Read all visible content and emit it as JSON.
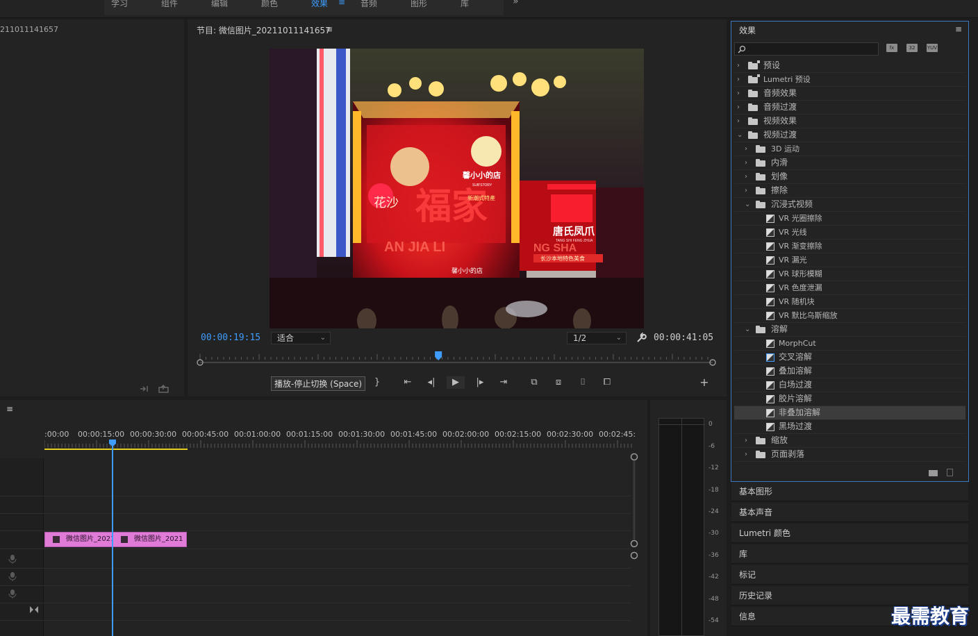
{
  "workspace": {
    "tabs": [
      {
        "label": "学习"
      },
      {
        "label": "组件"
      },
      {
        "label": "编辑"
      },
      {
        "label": "颜色"
      },
      {
        "label": "效果",
        "active": true
      },
      {
        "label": "音频"
      },
      {
        "label": "图形"
      },
      {
        "label": "库"
      }
    ],
    "more": "»",
    "active_menu": "≡"
  },
  "source": {
    "title": "211011141657"
  },
  "program": {
    "title": "节目: 微信图片_20211011141657",
    "menu": "≡",
    "timecode_current": "00:00:19:15",
    "timecode_duration": "00:00:41:05",
    "fit_value": "适合",
    "resolution_value": "1/2",
    "playhead_fraction": 0.465,
    "tooltip": "播放-停止切换 (Space)",
    "scene": {
      "sign_big": "福家",
      "sign_right": "唐氏凤爪",
      "sign_right_sub": "TANG SHI FENG ZHUA",
      "sign_left": "花沙",
      "sign_mid": "馨小小的店",
      "sign_mid_sub": "SUB'STORY",
      "sign_banner": "新潮式特產",
      "sign_bottom": "馨小小的店",
      "sign_red_strip": "长沙本地特色美食",
      "sign_roman": "AN JIA LI",
      "sign_roman2": "NG SHA"
    }
  },
  "timeline": {
    "menu": "≡",
    "ruler": [
      ":00:00",
      "00:00:15:00",
      "00:00:30:00",
      "00:00:45:00",
      "00:01:00:00",
      "00:01:15:00",
      "00:01:30:00",
      "00:01:45:00",
      "00:02:00:00",
      "00:02:15:00",
      "00:02:30:00",
      "00:02:45:"
    ],
    "clips": [
      {
        "label": "微信图片_2021"
      },
      {
        "label": "微信图片_2021"
      }
    ]
  },
  "meter": {
    "db_labels": [
      "0",
      "-6",
      "-12",
      "-18",
      "-24",
      "-30",
      "-36",
      "-42",
      "-48",
      "-54"
    ]
  },
  "effects": {
    "title": "效果",
    "menu": "≡",
    "search_value": "",
    "tools": [
      "fx",
      "32",
      "YUV"
    ],
    "tree": [
      {
        "label": "预设",
        "depth": 0,
        "kind": "preset",
        "open": false
      },
      {
        "label": "Lumetri 预设",
        "depth": 0,
        "kind": "preset",
        "open": false
      },
      {
        "label": "音频效果",
        "depth": 0,
        "kind": "folder",
        "open": false
      },
      {
        "label": "音频过渡",
        "depth": 0,
        "kind": "folder",
        "open": false
      },
      {
        "label": "视频效果",
        "depth": 0,
        "kind": "folder",
        "open": false
      },
      {
        "label": "视频过渡",
        "depth": 0,
        "kind": "folder",
        "open": true
      },
      {
        "label": "3D 运动",
        "depth": 1,
        "kind": "folder",
        "open": false
      },
      {
        "label": "内滑",
        "depth": 1,
        "kind": "folder",
        "open": false
      },
      {
        "label": "划像",
        "depth": 1,
        "kind": "folder",
        "open": false
      },
      {
        "label": "擦除",
        "depth": 1,
        "kind": "folder",
        "open": false
      },
      {
        "label": "沉浸式视频",
        "depth": 1,
        "kind": "folder",
        "open": true
      },
      {
        "label": "VR 光圈擦除",
        "depth": 2,
        "kind": "effect"
      },
      {
        "label": "VR 光线",
        "depth": 2,
        "kind": "effect"
      },
      {
        "label": "VR 渐变擦除",
        "depth": 2,
        "kind": "effect"
      },
      {
        "label": "VR 漏光",
        "depth": 2,
        "kind": "effect"
      },
      {
        "label": "VR 球形模糊",
        "depth": 2,
        "kind": "effect"
      },
      {
        "label": "VR 色度泄漏",
        "depth": 2,
        "kind": "effect"
      },
      {
        "label": "VR 随机块",
        "depth": 2,
        "kind": "effect"
      },
      {
        "label": "VR 默比乌斯缩放",
        "depth": 2,
        "kind": "effect"
      },
      {
        "label": "溶解",
        "depth": 1,
        "kind": "folder",
        "open": true
      },
      {
        "label": "MorphCut",
        "depth": 2,
        "kind": "effect"
      },
      {
        "label": "交叉溶解",
        "depth": 2,
        "kind": "effect"
      },
      {
        "label": "叠加溶解",
        "depth": 2,
        "kind": "effect"
      },
      {
        "label": "白场过渡",
        "depth": 2,
        "kind": "effect"
      },
      {
        "label": "胶片溶解",
        "depth": 2,
        "kind": "effect"
      },
      {
        "label": "非叠加溶解",
        "depth": 2,
        "kind": "effect",
        "selected": true
      },
      {
        "label": "黑场过渡",
        "depth": 2,
        "kind": "effect"
      },
      {
        "label": "缩放",
        "depth": 1,
        "kind": "folder",
        "open": false
      },
      {
        "label": "页面剥落",
        "depth": 1,
        "kind": "folder",
        "open": false
      }
    ]
  },
  "side_panels": [
    {
      "label": "基本图形"
    },
    {
      "label": "基本声音"
    },
    {
      "label": "Lumetri 颜色"
    },
    {
      "label": "库"
    },
    {
      "label": "标记"
    },
    {
      "label": "历史记录"
    },
    {
      "label": "信息"
    }
  ],
  "watermark": "最需教育",
  "colors": {
    "accent": "#3e9dff",
    "clip": "#e07bd7",
    "panel_bg": "#232323",
    "selected_row": "#3c3c3c"
  }
}
